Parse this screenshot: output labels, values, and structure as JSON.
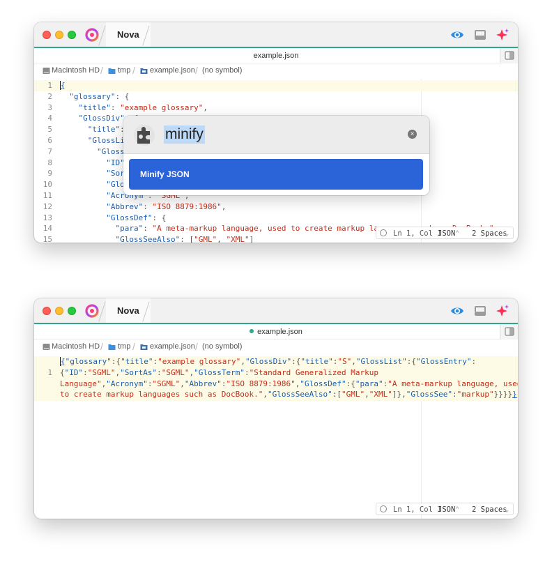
{
  "app": {
    "name": "Nova",
    "accent_color": "#2aa889"
  },
  "toolbar_icons": [
    "preview-eye-icon",
    "sidebar-panel-icon",
    "ai-sparkle-icon"
  ],
  "top_window": {
    "file_title": "example.json",
    "path": [
      "Macintosh HD",
      "tmp",
      "example.json",
      "(no symbol)"
    ],
    "line_numbers": [
      "1",
      "2",
      "3",
      "4",
      "5",
      "6",
      "7",
      "8",
      "9",
      "10",
      "11",
      "12",
      "13",
      "14",
      "15"
    ],
    "code_lines": [
      "{",
      "  \"glossary\": {",
      "    \"title\": \"example glossary\",",
      "    \"GlossDiv\": {",
      "      \"title\": \"S\",",
      "      \"GlossList\": {",
      "        \"GlossEntry\": {",
      "          \"ID\": \"SGML\",",
      "          \"SortAs\": \"SGML\",",
      "          \"GlossTerm\": \"Standard Generalized Markup Language\",",
      "          \"Acronym\": \"SGML\",",
      "          \"Abbrev\": \"ISO 8879:1986\",",
      "          \"GlossDef\": {",
      "            \"para\": \"A meta-markup language, used to create markup languages such as DocBook.\",",
      "            \"GlossSeeAlso\": [\"GML\", \"XML\"]"
    ],
    "status": {
      "position": "Ln 1, Col 1",
      "language": "JSON",
      "indent": "2 Spaces"
    }
  },
  "command_palette": {
    "query": "minify",
    "result": "Minify JSON"
  },
  "bottom_window": {
    "file_title": "example.json",
    "unsaved": true,
    "path": [
      "Macintosh HD",
      "tmp",
      "example.json",
      "(no symbol)"
    ],
    "line_numbers": [
      "1"
    ],
    "code_lines": [
      "{\"glossary\":{\"title\":\"example glossary\",\"GlossDiv\":{\"title\":\"S\",\"GlossList\":{\"GlossEntry\":",
      "{\"ID\":\"SGML\",\"SortAs\":\"SGML\",\"GlossTerm\":\"Standard Generalized Markup",
      "Language\",\"Acronym\":\"SGML\",\"Abbrev\":\"ISO 8879:1986\",\"GlossDef\":{\"para\":\"A meta-markup language, used",
      "to create markup languages such as DocBook.\",\"GlossSeeAlso\":[\"GML\",\"XML\"]},\"GlossSee\":\"markup\"}}}}}"
    ],
    "status": {
      "position": "Ln 1, Col 1",
      "language": "JSON",
      "indent": "2 Spaces"
    }
  }
}
